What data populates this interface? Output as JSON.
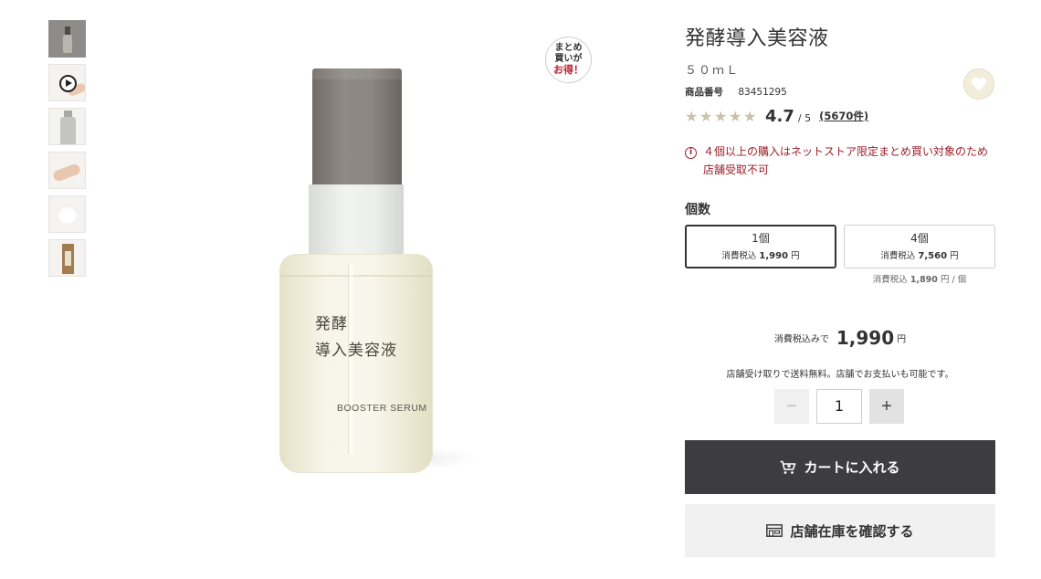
{
  "product": {
    "title": "発酵導入美容液",
    "volume": "５０ｍＬ",
    "code_label": "商品番号",
    "code_value": "83451295",
    "rating_value": "4.7",
    "rating_max": "/ 5",
    "rating_stars": 4.7,
    "review_count": "(5670件)",
    "label_jp_line1": "発酵",
    "label_jp_line2": "導入美容液",
    "label_en": "BOOSTER SERUM"
  },
  "badge": {
    "line1": "まとめ",
    "line2": "買いが",
    "line3": "お得！"
  },
  "notice": {
    "line1": "４個以上の購入はネットストア限定まとめ買い対象のため",
    "line2": "店舗受取不可"
  },
  "quantity": {
    "label": "個数",
    "options": [
      {
        "name": "1個",
        "tax_label": "消費税込",
        "price": "1,990",
        "unit": "円"
      },
      {
        "name": "4個",
        "tax_label": "消費税込",
        "price": "7,560",
        "unit": "円"
      }
    ],
    "per_unit_label": "消費税込",
    "per_unit_price": "1,890",
    "per_unit_suffix": "円 / 個"
  },
  "total": {
    "prefix": "消費税込みで",
    "amount": "1,990",
    "unit": "円"
  },
  "pickup_note": "店舗受け取りで送料無料。店舗でお支払いも可能です。",
  "stepper": {
    "value": "1",
    "minus": "−",
    "plus": "+"
  },
  "buttons": {
    "cart": "カートに入れる",
    "store": "店舗在庫を確認する"
  },
  "colors": {
    "primary_button": "#3d3d3f",
    "notice_red": "#9c1f2a",
    "star": "#c9c1a9",
    "favorite_bg": "#f3eddc"
  },
  "icons": {
    "favorite": "heart-icon",
    "cart": "cart-icon",
    "store": "store-icon",
    "notice": "alert-circle-icon",
    "video": "play-icon"
  }
}
